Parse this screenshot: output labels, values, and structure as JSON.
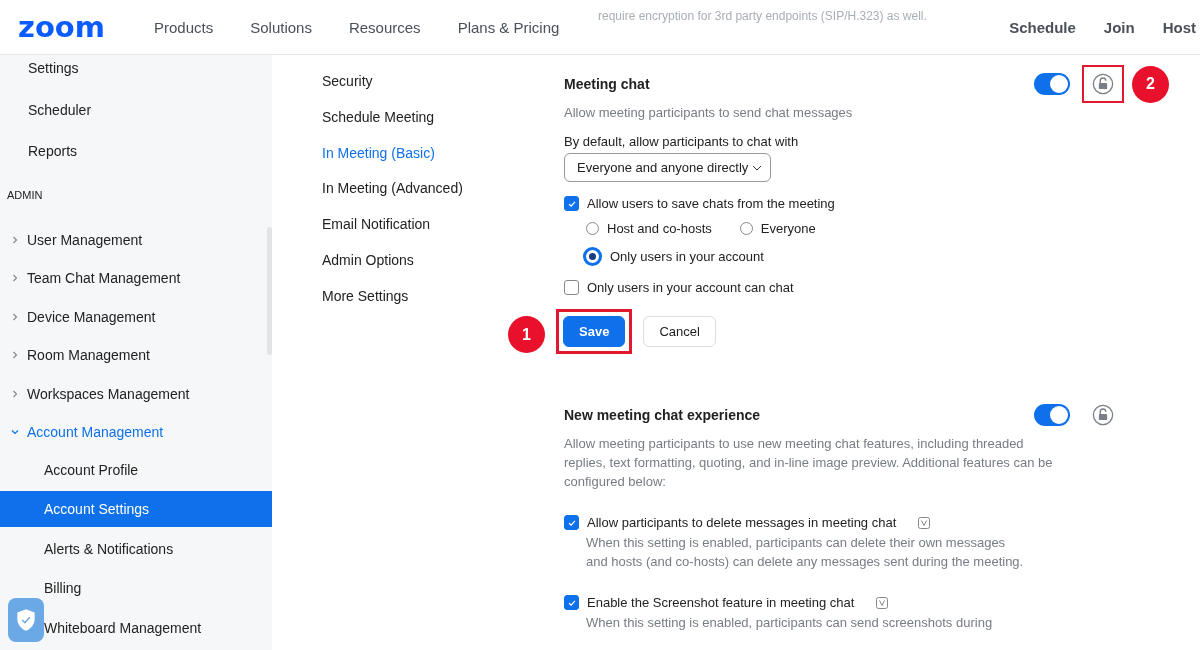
{
  "header": {
    "logo": "zoom",
    "nav": [
      "Products",
      "Solutions",
      "Resources",
      "Plans & Pricing"
    ],
    "faded_text": "require encryption for 3rd party endpoints (SIP/H.323) as well.",
    "actions": [
      "Schedule",
      "Join",
      "Host"
    ]
  },
  "sidebar": {
    "items": [
      {
        "label": "Settings",
        "selected": false
      },
      {
        "label": "Scheduler",
        "selected": false
      },
      {
        "label": "Reports",
        "selected": false
      }
    ],
    "section_heading": "ADMIN",
    "admin_items": [
      {
        "label": "User Management",
        "expanded": false
      },
      {
        "label": "Team Chat Management",
        "expanded": false
      },
      {
        "label": "Device Management",
        "expanded": false
      },
      {
        "label": "Room Management",
        "expanded": false
      },
      {
        "label": "Workspaces Management",
        "expanded": false
      },
      {
        "label": "Account Management",
        "expanded": true,
        "children": [
          {
            "label": "Account Profile",
            "selected": false
          },
          {
            "label": "Account Settings",
            "selected": true
          },
          {
            "label": "Alerts & Notifications",
            "selected": false
          },
          {
            "label": "Billing",
            "selected": false
          },
          {
            "label": "Whiteboard Management",
            "selected": false
          }
        ]
      }
    ]
  },
  "subnav": [
    {
      "label": "Security",
      "selected": false
    },
    {
      "label": "Schedule Meeting",
      "selected": false
    },
    {
      "label": "In Meeting (Basic)",
      "selected": true
    },
    {
      "label": "In Meeting (Advanced)",
      "selected": false
    },
    {
      "label": "Email Notification",
      "selected": false
    },
    {
      "label": "Admin Options",
      "selected": false
    },
    {
      "label": "More Settings",
      "selected": false
    }
  ],
  "settings": [
    {
      "title": "Meeting chat",
      "on": true,
      "lock_highlighted": true,
      "lock_badge": "2",
      "description": "Allow meeting participants to send chat messages",
      "dropdown": {
        "label": "By default, allow participants to chat with",
        "value": "Everyone and anyone directly"
      },
      "options": [
        {
          "kind": "checkbox",
          "label": "Allow users to save chats from the meeting",
          "checked": true,
          "radios": [
            {
              "label": "Host and co-hosts",
              "selected": false
            },
            {
              "label": "Everyone",
              "selected": false
            },
            {
              "label": "Only users in your account",
              "selected": true
            }
          ]
        },
        {
          "kind": "checkbox",
          "label": "Only users in your account can chat",
          "checked": false
        }
      ],
      "buttons": [
        {
          "label": "Save",
          "kind": "primary",
          "highlighted": true,
          "badge": "1"
        },
        {
          "label": "Cancel",
          "kind": "secondary",
          "highlighted": false
        }
      ]
    },
    {
      "title": "New meeting chat experience",
      "on": true,
      "lock_highlighted": false,
      "description": "Allow meeting participants to use new meeting chat features, including threaded replies, text formatting, quoting, and in-line image preview. Additional features can be configured below:",
      "options": [
        {
          "kind": "checkbox",
          "label": "Allow participants to delete messages in meeting chat",
          "checked": true,
          "version_tag": true,
          "description": "When this setting is enabled, participants can delete their own messages and hosts (and co-hosts) can delete any messages sent during the meeting."
        },
        {
          "kind": "checkbox",
          "label": "Enable the Screenshot feature in meeting chat",
          "checked": true,
          "version_tag": true,
          "description": "When this setting is enabled, participants can send screenshots during"
        }
      ]
    }
  ]
}
